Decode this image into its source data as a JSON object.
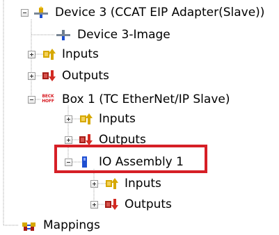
{
  "tree": {
    "nodes": [
      {
        "id": "device3",
        "label": "Device 3 (CCAT EIP Adapter(Slave))",
        "icon": "device-adapter-icon",
        "expanded": true
      },
      {
        "id": "device3-image",
        "label": "Device 3-Image",
        "icon": "image-icon"
      },
      {
        "id": "device3-inputs",
        "label": "Inputs",
        "icon": "inputs-icon",
        "expanded": false
      },
      {
        "id": "device3-outputs",
        "label": "Outputs",
        "icon": "outputs-icon",
        "expanded": false
      },
      {
        "id": "box1",
        "label": "Box 1 (TC EtherNet/IP Slave)",
        "icon": "beckhoff-box-icon",
        "icon_text": "BECK\nHOFF",
        "expanded": true
      },
      {
        "id": "box1-inputs",
        "label": "Inputs",
        "icon": "inputs-icon",
        "expanded": false
      },
      {
        "id": "box1-outputs",
        "label": "Outputs",
        "icon": "outputs-icon",
        "expanded": false
      },
      {
        "id": "io-assembly-1",
        "label": "IO Assembly 1",
        "icon": "io-assembly-icon",
        "expanded": true,
        "highlighted": true
      },
      {
        "id": "assembly-inputs",
        "label": "Inputs",
        "icon": "inputs-icon",
        "expanded": false
      },
      {
        "id": "assembly-outputs",
        "label": "Outputs",
        "icon": "outputs-icon",
        "expanded": false
      },
      {
        "id": "mappings",
        "label": "Mappings",
        "icon": "mappings-icon"
      }
    ]
  },
  "colors": {
    "highlight": "#d61f26",
    "tree_line": "#a0a0a0",
    "inputs_icon": "#d6a800",
    "outputs_icon": "#a61d18",
    "io_assembly_icon": "#1f4fd1"
  }
}
